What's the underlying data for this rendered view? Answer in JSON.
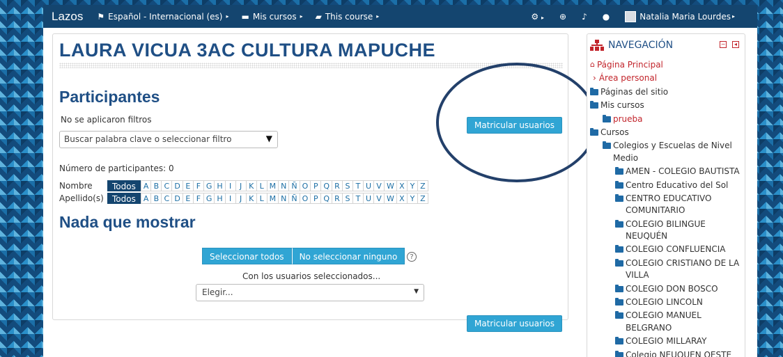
{
  "navbar": {
    "brand": "Lazos",
    "language": "Español - Internacional (es)",
    "my_courses": "Mis cursos",
    "this_course": "This course",
    "user_name": "Natalia Maria Lourdes",
    "icons": [
      "flag-icon",
      "briefcase-icon",
      "book-icon",
      "gear-icon",
      "plus-circle-icon",
      "bell-icon",
      "chat-icon"
    ],
    "caret": "▸"
  },
  "course": {
    "title": "LAURA VICUA 3AC CULTURA MAPUCHE"
  },
  "participants": {
    "heading": "Participantes",
    "no_filters": "No se aplicaron filtros",
    "filter_placeholder": "Buscar palabra clave o seleccionar filtro",
    "enrol_button": "Matricular usuarios",
    "count_text": "Número de participantes: 0",
    "first_name_label": "Nombre",
    "last_name_label": "Apellido(s)",
    "all_label": "Todos",
    "letters": [
      "A",
      "B",
      "C",
      "D",
      "E",
      "F",
      "G",
      "H",
      "I",
      "J",
      "K",
      "L",
      "M",
      "N",
      "Ñ",
      "O",
      "P",
      "Q",
      "R",
      "S",
      "T",
      "U",
      "V",
      "W",
      "X",
      "Y",
      "Z"
    ],
    "nothing_heading": "Nada que mostrar",
    "select_all": "Seleccionar todos",
    "deselect_all": "No seleccionar ninguno",
    "help_symbol": "?",
    "with_selected": "Con los usuarios seleccionados...",
    "choose_placeholder": "Elegir...",
    "enrol_button_bottom": "Matricular usuarios"
  },
  "navigation": {
    "title": "NAVEGACIÓN",
    "items": [
      {
        "label": "Página Principal",
        "type": "home"
      },
      {
        "label": "Área personal",
        "type": "chevron"
      },
      {
        "label": "Páginas del sitio",
        "type": "folder"
      },
      {
        "label": "Mis cursos",
        "type": "folder-open"
      },
      {
        "label": "prueba",
        "type": "folder"
      },
      {
        "label": "Cursos",
        "type": "folder-open"
      },
      {
        "label": "Colegios y Escuelas de Nivel Medio",
        "type": "folder-open"
      },
      {
        "label": "AMEN - COLEGIO BAUTISTA",
        "type": "folder"
      },
      {
        "label": "Centro Educativo del Sol",
        "type": "folder"
      },
      {
        "label": "CENTRO EDUCATIVO COMUNITARIO",
        "type": "folder"
      },
      {
        "label": "COLEGIO BILINGUE NEUQUÉN",
        "type": "folder"
      },
      {
        "label": "COLEGIO CONFLUENCIA",
        "type": "folder"
      },
      {
        "label": "COLEGIO CRISTIANO DE LA VILLA",
        "type": "folder"
      },
      {
        "label": "COLEGIO DON BOSCO",
        "type": "folder"
      },
      {
        "label": "COLEGIO LINCOLN",
        "type": "folder"
      },
      {
        "label": "COLEGIO MANUEL BELGRANO",
        "type": "folder"
      },
      {
        "label": "COLEGIO MILLARAY",
        "type": "folder"
      },
      {
        "label": "Colegio NEUQUEN OESTE",
        "type": "folder"
      }
    ]
  },
  "colors": {
    "navbar": "#14456f",
    "heading": "#1f4f85",
    "button": "#30a5d4",
    "link": "#c2242b"
  }
}
